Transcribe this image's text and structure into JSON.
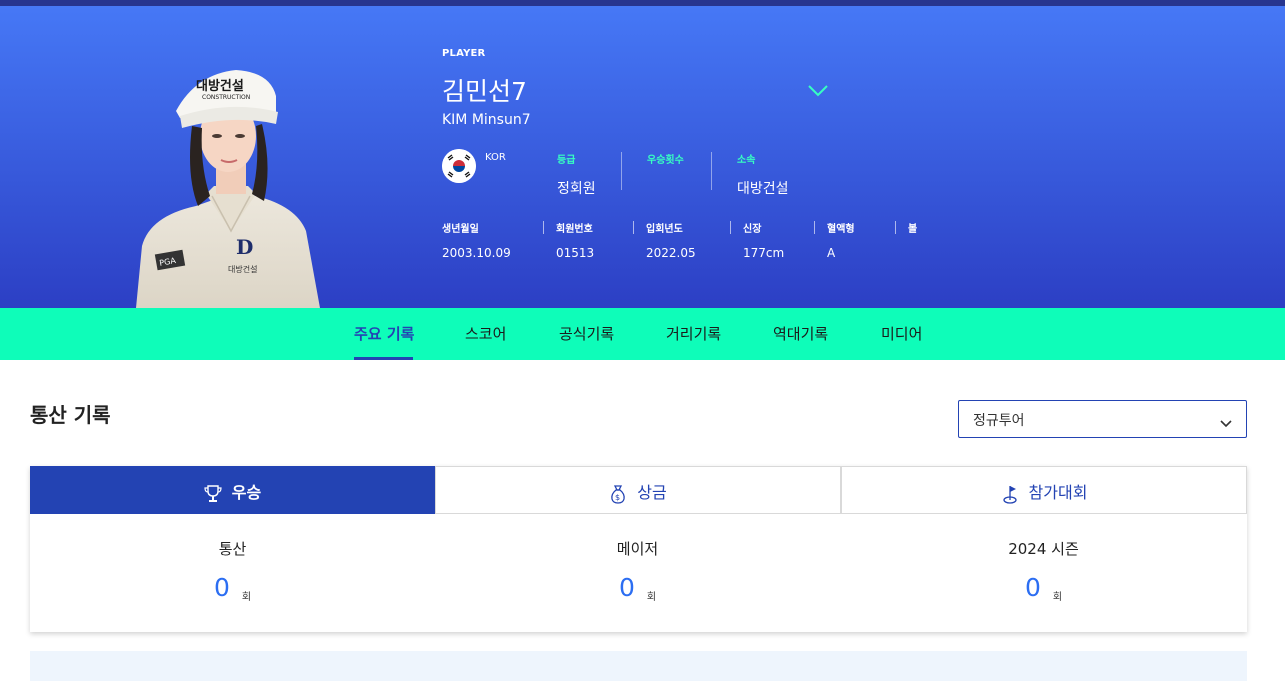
{
  "hero": {
    "tag": "PLAYER",
    "name_ko": "김민선7",
    "name_en": "KIM Minsun7",
    "country": "KOR",
    "info": [
      {
        "label": "등급",
        "value": "정회원"
      },
      {
        "label": "우승횟수",
        "value": ""
      },
      {
        "label": "소속",
        "value": "대방건설"
      }
    ],
    "details": [
      {
        "label": "생년월일",
        "value": "2003.10.09"
      },
      {
        "label": "회원번호",
        "value": "01513"
      },
      {
        "label": "입회년도",
        "value": "2022.05"
      },
      {
        "label": "신장",
        "value": "177cm"
      },
      {
        "label": "혈액형",
        "value": "A"
      },
      {
        "label": "볼",
        "value": ""
      }
    ],
    "photo_cap_text": "대방건설",
    "photo_cap_subtext": "CONSTRUCTION",
    "photo_shirt_text": "대방건설",
    "photo_logo_text": "D",
    "photo_pga_text": "PGA"
  },
  "nav": {
    "tabs": [
      "주요 기록",
      "스코어",
      "공식기록",
      "거리기록",
      "역대기록",
      "미디어"
    ],
    "active_index": 0
  },
  "section": {
    "title": "통산 기록",
    "tour_select": "정규투어"
  },
  "record_tabs": [
    {
      "label": "우승",
      "icon": "trophy-icon",
      "active": true
    },
    {
      "label": "상금",
      "icon": "money-bag-icon",
      "active": false
    },
    {
      "label": "참가대회",
      "icon": "golf-flag-icon",
      "active": false
    }
  ],
  "stats": [
    {
      "label": "통산",
      "value": "0",
      "unit": "회"
    },
    {
      "label": "메이저",
      "value": "0",
      "unit": "회"
    },
    {
      "label": "2024 시즌",
      "value": "0",
      "unit": "회"
    }
  ],
  "colors": {
    "primary": "#2343b3",
    "mint": "#0efdb9",
    "stat_value": "#2c6ef2"
  }
}
